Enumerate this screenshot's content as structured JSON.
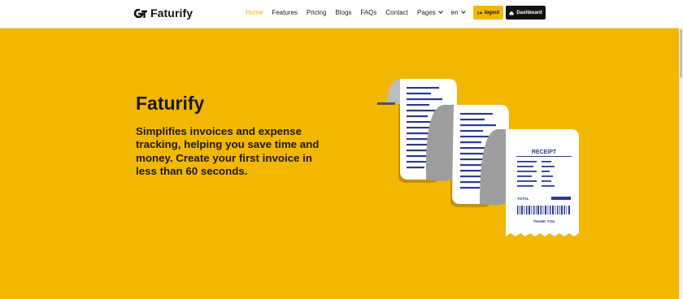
{
  "brand": {
    "name": "Faturify"
  },
  "nav": {
    "home": "Home",
    "features": "Features",
    "pricing": "Pricing",
    "blogs": "Blogs",
    "faqs": "FAQs",
    "contact": "Contact",
    "pages": "Pages",
    "language": "en"
  },
  "buttons": {
    "logout": "logout",
    "dashboard": "Dashboard"
  },
  "hero": {
    "title": "Faturify",
    "description": "Simplifies invoices and expense tracking, helping you save time and money. Create your first invoice in less than 60 seconds."
  },
  "receipt": {
    "title": "RECEIPT",
    "total_label": "TOTAL",
    "footer": "THANK YOU"
  },
  "colors": {
    "accent": "#f2b700",
    "dark": "#111111",
    "ink": "#2d3a8c"
  }
}
